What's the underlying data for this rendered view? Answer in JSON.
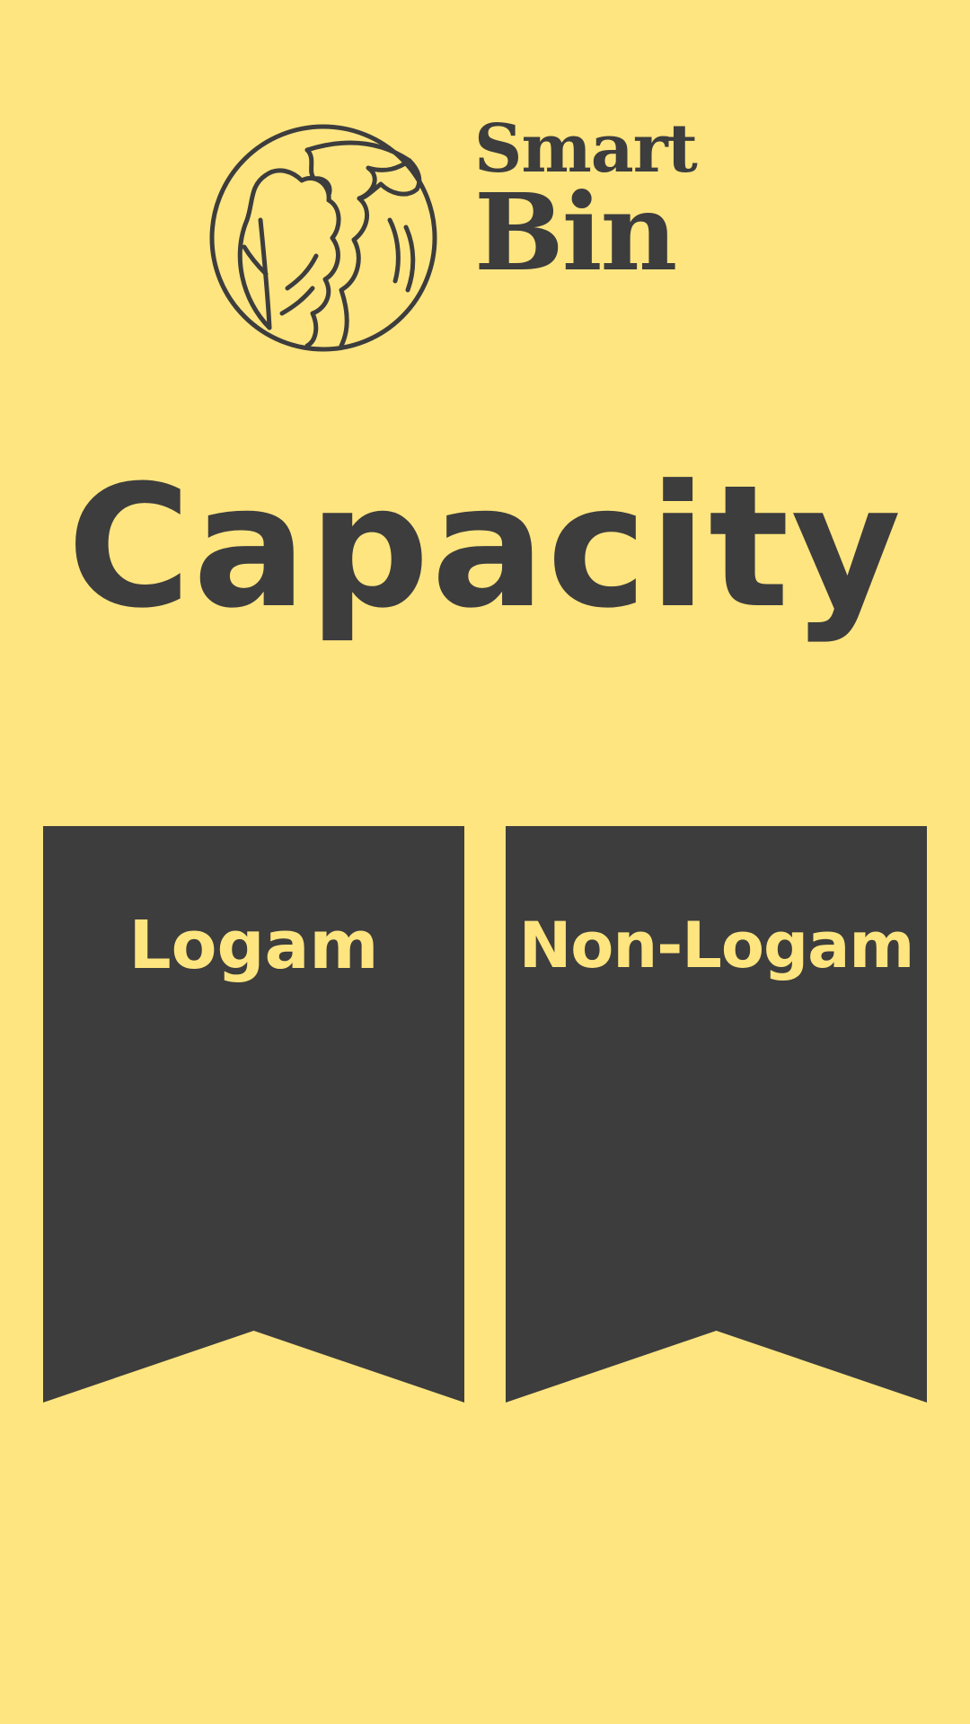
{
  "brand": {
    "line1": "Smart",
    "line2": "Bin",
    "logo_icon": "lettuce-globe-icon"
  },
  "page": {
    "title": "Capacity"
  },
  "categories": [
    {
      "label": "Logam"
    },
    {
      "label": "Non-Logam"
    }
  ],
  "colors": {
    "background": "#FFE57F",
    "dark": "#3D3D3D",
    "accent_text": "#FFE57F"
  }
}
